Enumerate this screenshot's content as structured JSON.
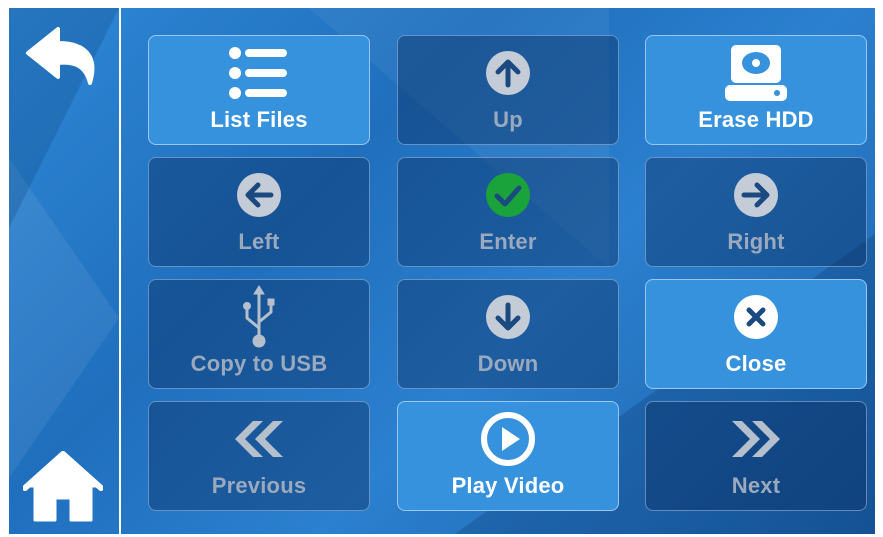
{
  "navigation": {
    "back_icon": "back-arrow-icon",
    "home_icon": "home-icon"
  },
  "colors": {
    "background": "#1f6fbd",
    "tile_active": "#3792de",
    "tile_inactive": "#19497f",
    "label_inactive": "#9aa9bd",
    "enter_green": "#1aa33a"
  },
  "tiles": [
    {
      "label": "List Files",
      "icon": "list-icon",
      "state": "active"
    },
    {
      "label": "Up",
      "icon": "arrow-up-circle-icon",
      "state": "inactive"
    },
    {
      "label": "Erase HDD",
      "icon": "hard-drive-icon",
      "state": "active"
    },
    {
      "label": "Left",
      "icon": "arrow-left-circle-icon",
      "state": "inactive"
    },
    {
      "label": "Enter",
      "icon": "check-circle-icon",
      "state": "inactive"
    },
    {
      "label": "Right",
      "icon": "arrow-right-circle-icon",
      "state": "inactive"
    },
    {
      "label": "Copy to USB",
      "icon": "usb-icon",
      "state": "inactive"
    },
    {
      "label": "Down",
      "icon": "arrow-down-circle-icon",
      "state": "inactive"
    },
    {
      "label": "Close",
      "icon": "close-circle-icon",
      "state": "active"
    },
    {
      "label": "Previous",
      "icon": "double-chevron-left-icon",
      "state": "inactive"
    },
    {
      "label": "Play Video",
      "icon": "play-circle-icon",
      "state": "active"
    },
    {
      "label": "Next",
      "icon": "double-chevron-right-icon",
      "state": "inactive"
    }
  ]
}
